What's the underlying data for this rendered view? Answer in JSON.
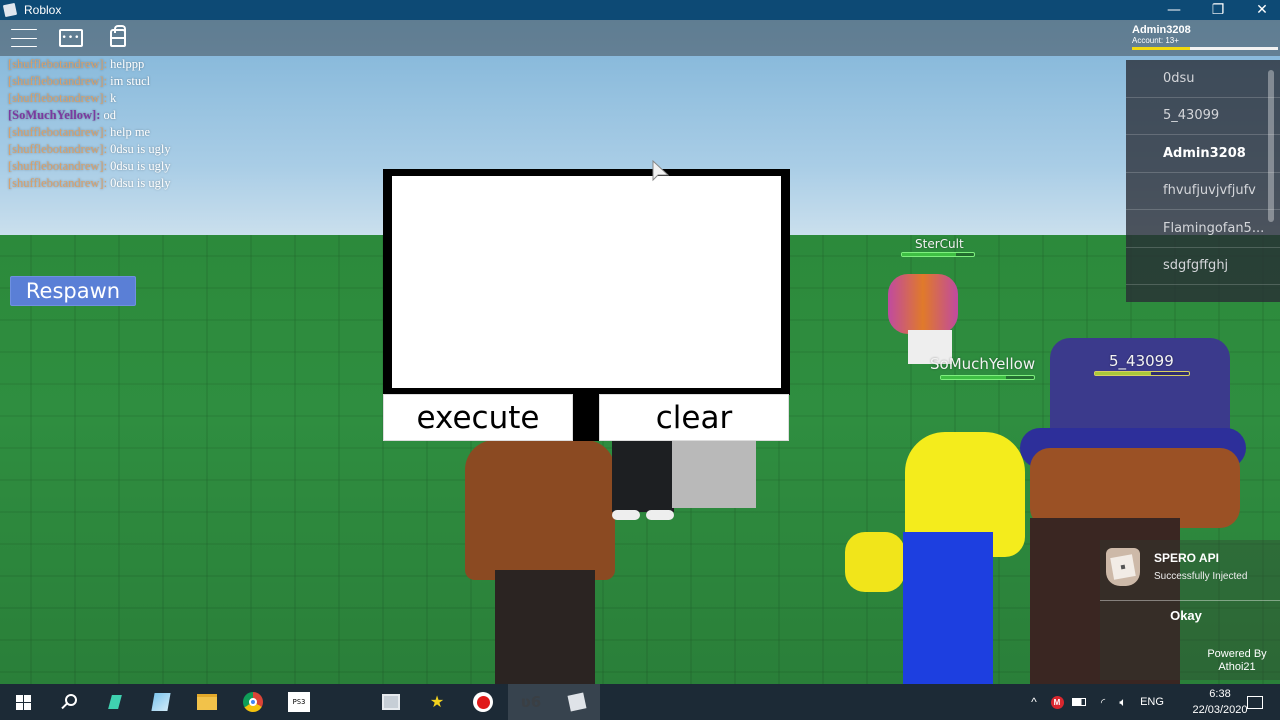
{
  "window": {
    "title": "Roblox",
    "controls": {
      "minimize": "—",
      "restore": "❐",
      "close": "✕"
    }
  },
  "topbar": {
    "icons": [
      "menu-icon",
      "chat-icon",
      "backpack-icon"
    ]
  },
  "account": {
    "username": "Admin3208",
    "age_label": "Account: 13+",
    "bar_fill_fraction": 0.4,
    "bar_color": "#f1d90f"
  },
  "chat": [
    {
      "user": "[shufflebotandrew]:",
      "message": "helppp",
      "color": "#d9a06a"
    },
    {
      "user": "[shufflebotandrew]:",
      "message": "im stucl",
      "color": "#d9a06a"
    },
    {
      "user": "[shufflebotandrew]:",
      "message": "k",
      "color": "#d9a06a"
    },
    {
      "user": "[SoMuchYellow]:",
      "message": "od",
      "color": "#7b3aa0"
    },
    {
      "user": "[shufflebotandrew]:",
      "message": "help me",
      "color": "#d9a06a"
    },
    {
      "user": "[shufflebotandrew]:",
      "message": "0dsu is ugly",
      "color": "#d9a06a"
    },
    {
      "user": "[shufflebotandrew]:",
      "message": "0dsu is ugly",
      "color": "#d9a06a"
    },
    {
      "user": "[shufflebotandrew]:",
      "message": "0dsu is ugly",
      "color": "#d9a06a"
    }
  ],
  "respawn": {
    "label": "Respawn",
    "color": "#5a7fd6"
  },
  "executor": {
    "script_value": "",
    "execute_label": "execute",
    "clear_label": "clear"
  },
  "player_list": [
    {
      "name": "0dsu",
      "is_self": false
    },
    {
      "name": "5_43099",
      "is_self": false
    },
    {
      "name": "Admin3208",
      "is_self": true
    },
    {
      "name": "fhvufjuvjvfjufv",
      "is_self": false
    },
    {
      "name": "Flamingofan5...",
      "is_self": false
    },
    {
      "name": "sdgfgffghj",
      "is_self": false
    }
  ],
  "nameplates": [
    {
      "name": "SterCult",
      "health_fraction": 0.75
    },
    {
      "name": "SoMuchYellow",
      "health_fraction": 0.7
    },
    {
      "name": "5_43099",
      "health_fraction": 0.6
    }
  ],
  "notification": {
    "title": "SPERO API",
    "subtitle": "Successfully Injected",
    "ok_label": "Okay",
    "powered_by": "Powered By",
    "author": "Athoi21"
  },
  "taskbar": {
    "apps": [
      "windows-start",
      "search",
      "filmora",
      "notepad",
      "file-explorer",
      "chrome",
      "ps3",
      "blank",
      "task-manager",
      "star-app",
      "recorder",
      "vegas",
      "roblox"
    ],
    "tray": {
      "language": "ENG",
      "time": "6:38",
      "date": "22/03/2020"
    }
  }
}
